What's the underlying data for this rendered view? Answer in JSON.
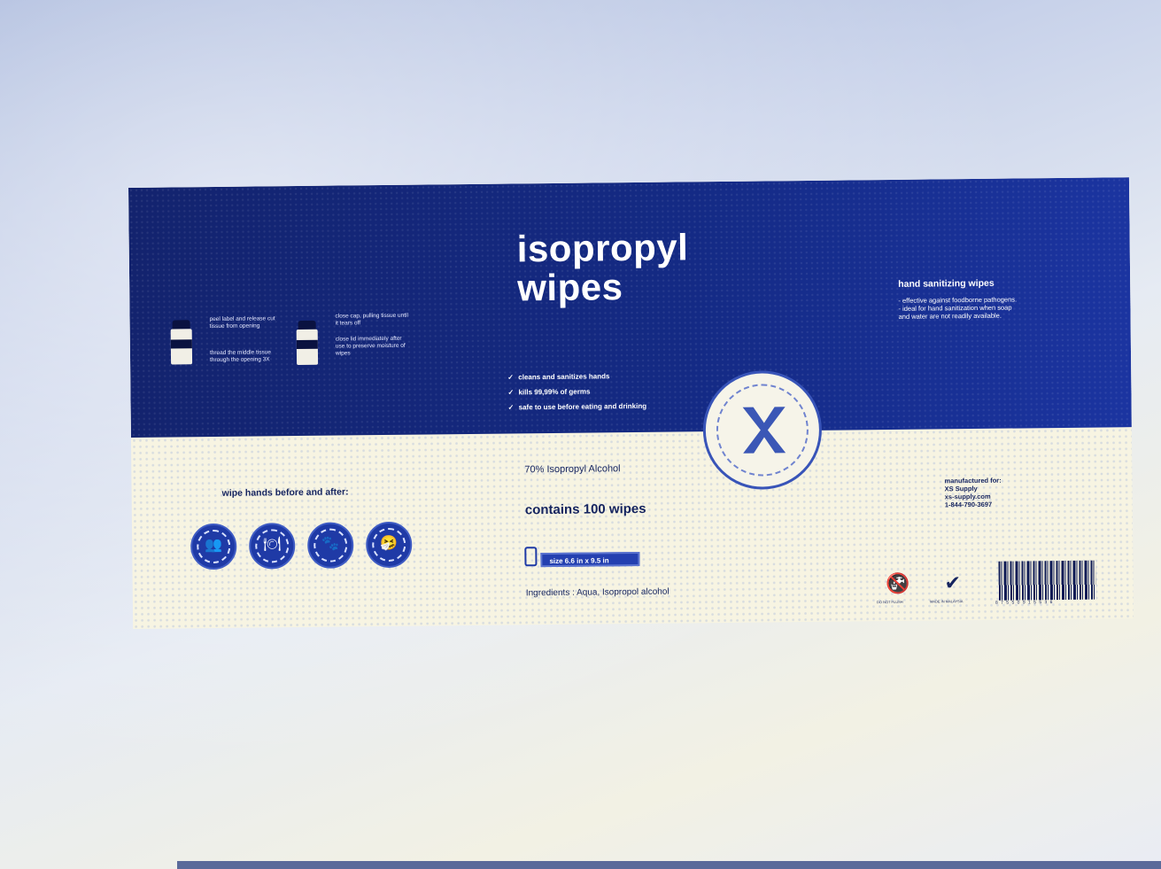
{
  "label": {
    "instructions": {
      "title": "",
      "steps_left": [
        "peel label and release cut tissue from opening",
        "thread the middle tissue through the opening 3X"
      ],
      "steps_right": [
        "close cap, pulling tissue until it tears off",
        "close lid immediately after use to preserve moisture of wipes"
      ]
    },
    "title_line1": "isopropyl",
    "title_line2": "wipes",
    "subtitle": "",
    "checks": [
      "cleans and sanitizes hands",
      "kills 99,99% of germs",
      "safe to use before eating and drinking"
    ],
    "check_symbol": "✓",
    "right_heading": "hand sanitizing wipes",
    "right_bullets": [
      "- effective against foodborne pathogens.",
      "- ideal for hand sanitization when soap",
      "  and water are not readily available."
    ],
    "seal_icon": "xs-logo-icon",
    "wipe_heading": "wipe hands before and after:",
    "pictograms": [
      {
        "icon": "people-icon",
        "glyph": "👥"
      },
      {
        "icon": "plate-icon",
        "glyph": "🍽"
      },
      {
        "icon": "pet-icon",
        "glyph": "🐾"
      },
      {
        "icon": "sneeze-icon",
        "glyph": "🤧"
      }
    ],
    "alcohol": "70% Isopropyl Alcohol",
    "contains": "contains 100 wipes",
    "size": "size 6.6 in x 9.5 in",
    "ingredients": "Ingredients : Aqua, Isopropol alcohol",
    "manufacturer": [
      "manufactured for:",
      "XS Supply",
      "xs-supply.com",
      "1-844-790-3697"
    ],
    "marks": [
      {
        "icon": "do-not-flush-icon",
        "glyph": "🚱",
        "caption": "DO NOT FLUSH"
      },
      {
        "icon": "checkmark-icon",
        "glyph": "✔",
        "caption": "MADE IN MALAYSIA"
      }
    ],
    "barcode_number": "8 7 5 5 0 9 1 5 5 3 6"
  },
  "colors": {
    "navy": "#13236e",
    "accent_blue": "#2440b0",
    "cream": "#f7f4e2"
  }
}
